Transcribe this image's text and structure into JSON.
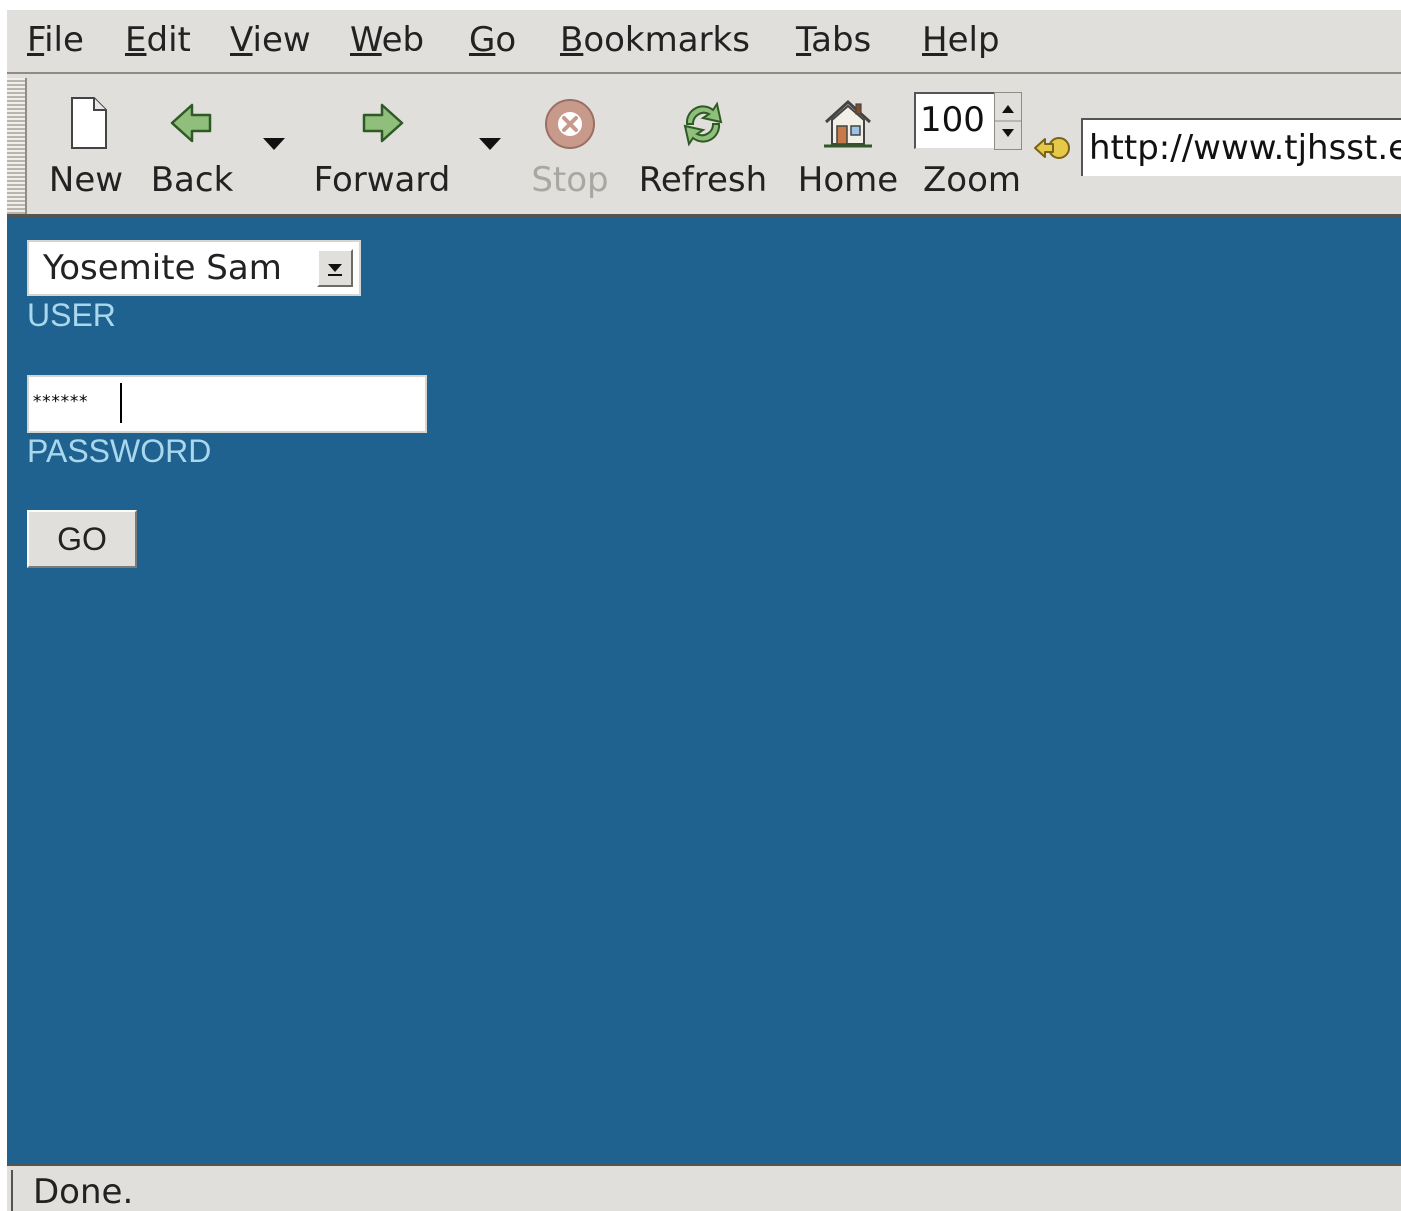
{
  "menubar": {
    "items": [
      {
        "label": "File",
        "mnemonic": "F",
        "rest": "ile"
      },
      {
        "label": "Edit",
        "mnemonic": "E",
        "rest": "dit"
      },
      {
        "label": "View",
        "mnemonic": "V",
        "rest": "iew"
      },
      {
        "label": "Web",
        "mnemonic": "W",
        "rest": "eb"
      },
      {
        "label": "Go",
        "mnemonic": "G",
        "rest": "o"
      },
      {
        "label": "Bookmarks",
        "mnemonic": "B",
        "rest": "ookmarks"
      },
      {
        "label": "Tabs",
        "mnemonic": "T",
        "rest": "abs"
      },
      {
        "label": "Help",
        "mnemonic": "H",
        "rest": "elp"
      }
    ]
  },
  "toolbar": {
    "new_label": "New",
    "back_label": "Back",
    "forward_label": "Forward",
    "stop_label": "Stop",
    "refresh_label": "Refresh",
    "home_label": "Home",
    "zoom_label": "Zoom",
    "zoom_value": "100",
    "url_value": "http://www.tjhsst.edu",
    "icons": {
      "new": "document-new-icon",
      "back": "arrow-left-icon",
      "forward": "arrow-right-icon",
      "stop": "stop-icon",
      "refresh": "refresh-icon",
      "home": "home-icon",
      "go": "go-arrow-icon"
    },
    "stop_enabled": false
  },
  "login": {
    "user_selected": "Yosemite Sam",
    "user_label": "USER",
    "password_masked": "******",
    "password_label": "PASSWORD",
    "submit_label": "GO"
  },
  "status": {
    "text": "Done."
  },
  "colors": {
    "content_background": "#1f6290",
    "label_color": "#a9d8ee",
    "chrome_background": "#e0dfdb"
  }
}
